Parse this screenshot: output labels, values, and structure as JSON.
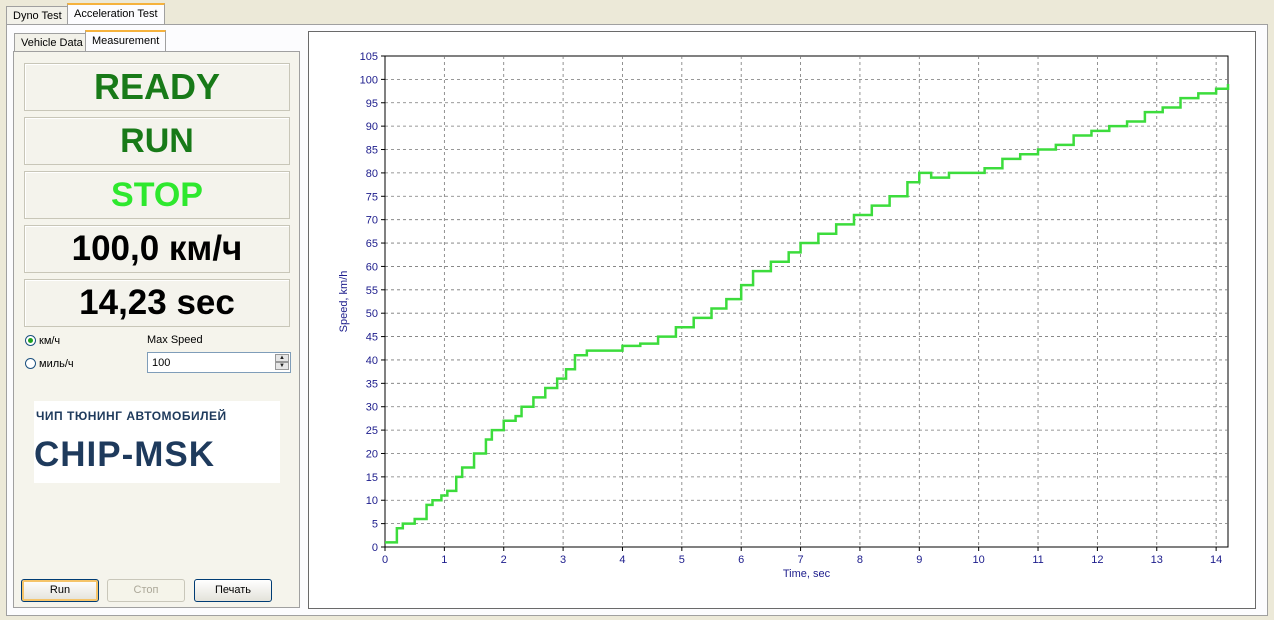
{
  "tabs": [
    "Dyno Test",
    "Acceleration Test"
  ],
  "subtabs": [
    "Vehicle Data",
    "Measurement"
  ],
  "status": {
    "ready": "READY",
    "run": "RUN",
    "stop": "STOP"
  },
  "readouts": {
    "speed": "100,0 км/ч",
    "time": "14,23 sec"
  },
  "units": {
    "kmh": "км/ч",
    "mph": "миль/ч",
    "selected": "км/ч"
  },
  "max_speed": {
    "label": "Max Speed",
    "value": "100"
  },
  "logo": {
    "small": "ЧИП ТЮНИНГ АВТОМОБИЛЕЙ",
    "big": "CHIP-MSK"
  },
  "buttons": {
    "run": "Run",
    "stop": "Стоп",
    "print": "Печать"
  },
  "colors": {
    "ready": "#187a18",
    "run": "#187a18",
    "stop": "#2ee82e",
    "curve": "#3cdc3c",
    "axis_text": "#1c1c8c"
  },
  "chart_data": {
    "type": "line",
    "xlabel": "Time, sec",
    "ylabel": "Speed, km/h",
    "xlim": [
      0,
      14.2
    ],
    "ylim": [
      0,
      105
    ],
    "x_ticks": [
      0,
      1,
      2,
      3,
      4,
      5,
      6,
      7,
      8,
      9,
      10,
      11,
      12,
      13,
      14
    ],
    "y_ticks": [
      0,
      5,
      10,
      15,
      20,
      25,
      30,
      35,
      40,
      45,
      50,
      55,
      60,
      65,
      70,
      75,
      80,
      85,
      90,
      95,
      100,
      105
    ],
    "grid": true,
    "series": [
      {
        "x": [
          0,
          0.2,
          0.3,
          0.5,
          0.7,
          0.8,
          0.95,
          1.05,
          1.2,
          1.3,
          1.5,
          1.7,
          1.8,
          2.0,
          2.2,
          2.3,
          2.5,
          2.7,
          2.9,
          3.05,
          3.2,
          3.4,
          3.7,
          4.0,
          4.3,
          4.6,
          4.9,
          5.2,
          5.5,
          5.75,
          6.0,
          6.2,
          6.5,
          6.8,
          7.0,
          7.3,
          7.6,
          7.9,
          8.2,
          8.5,
          8.8,
          9.0,
          9.2,
          9.5,
          9.8,
          10.1,
          10.4,
          10.7,
          11.0,
          11.3,
          11.6,
          11.9,
          12.2,
          12.5,
          12.8,
          13.1,
          13.4,
          13.7,
          14.0,
          14.2
        ],
        "y": [
          1,
          4,
          5,
          6,
          9,
          10,
          11,
          12,
          15,
          17,
          20,
          23,
          25,
          27,
          28,
          30,
          32,
          34,
          36,
          38,
          41,
          42,
          42,
          43,
          43.5,
          45,
          47,
          49,
          51,
          53,
          56,
          59,
          61,
          63,
          65,
          67,
          69,
          71,
          73,
          75,
          78,
          80,
          79,
          80,
          80,
          81,
          83,
          84,
          85,
          86,
          88,
          89,
          90,
          91,
          93,
          94,
          96,
          97,
          98,
          99
        ]
      }
    ]
  }
}
